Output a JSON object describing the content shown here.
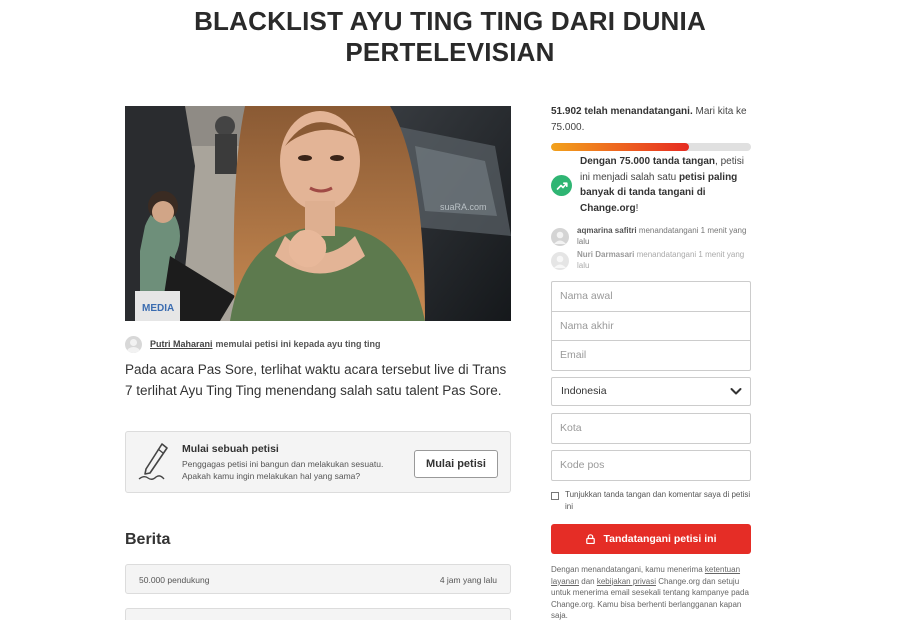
{
  "petition": {
    "title": "BLACKLIST AYU TING TING DARI DUNIA PERTELEVISIAN",
    "starter_name": "Putri Maharani",
    "starter_text": "memulai petisi ini kepada ayu ting ting",
    "description": "Pada acara Pas Sore, terlihat waktu acara tersebut live di Trans 7 terlihat Ayu Ting Ting menendang salah satu talent Pas Sore."
  },
  "photo": {
    "icon": "petition-photo",
    "watermark": "suaRA.com"
  },
  "start_box": {
    "icon": "pen-icon",
    "heading": "Mulai sebuah petisi",
    "line1": "Penggagas petisi ini bangun dan melakukan sesuatu.",
    "line2": "Apakah kamu ingin melakukan hal yang sama?",
    "button_label": "Mulai petisi"
  },
  "news": {
    "heading": "Berita",
    "items": [
      {
        "left": "50.000 pendukung",
        "right": "4 jam yang lalu"
      }
    ]
  },
  "progress": {
    "count_text": "51.902 telah menandatangani.",
    "goal_text": "Mari kita ke 75.000.",
    "fraction": 0.69,
    "colors": {
      "start": "#f2a21c",
      "end": "#e62b21",
      "track": "#e0e0e0"
    }
  },
  "goal_message": {
    "icon": "trending-up-icon",
    "bold1": "Dengan 75.000 tanda tangan",
    "part2": ", petisi ini menjadi salah satu ",
    "bold2": "petisi paling banyak di tanda tangani di Change.org",
    "part3": "!"
  },
  "recent_signers": [
    {
      "name": "aqmarina safitri",
      "text": "menandatangani 1 menit yang lalu"
    },
    {
      "name": "Nuri Darmasari",
      "text": "menandatangani 1 menit yang lalu"
    }
  ],
  "form": {
    "first_name_placeholder": "Nama awal",
    "last_name_placeholder": "Nama akhir",
    "email_placeholder": "Email",
    "country_value": "Indonesia",
    "city_placeholder": "Kota",
    "postal_placeholder": "Kode pos",
    "consent_label": "Tunjukkan tanda tangan dan komentar saya di petisi ini",
    "sign_button": "Tandatangani petisi ini",
    "sign_color": "#e52d26"
  },
  "legal": {
    "t1": "Dengan menandatangani, kamu menerima ",
    "link1": "ketentuan layanan",
    "t2": " dan ",
    "link2": "kebijakan privasi",
    "t3": " Change.org dan setuju untuk menerima email sesekali tentang kampanye pada Change.org. Kamu bisa berhenti berlangganan kapan saja."
  }
}
